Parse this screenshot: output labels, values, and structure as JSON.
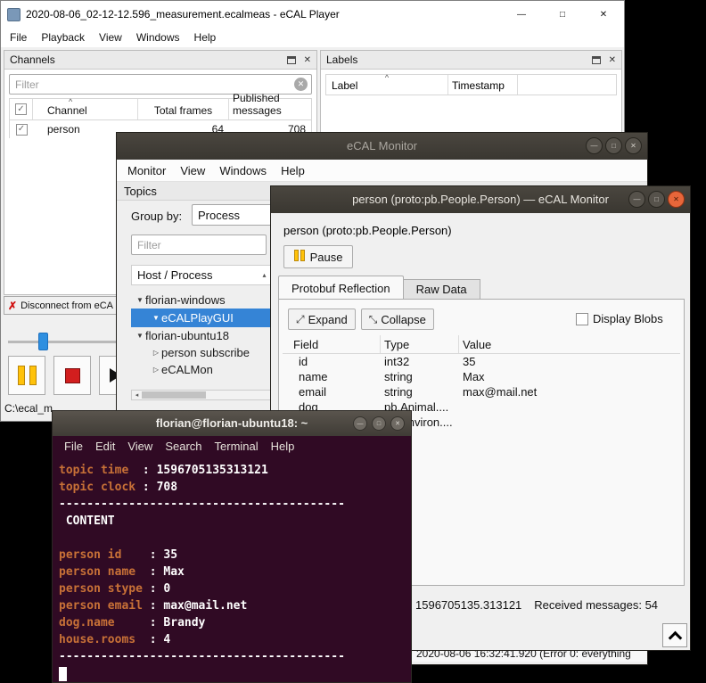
{
  "colors": {
    "selection_blue": "#3584D6",
    "pause_yellow": "#FFC20A",
    "stop_red": "#D21E1E",
    "close_orange": "#E8663A",
    "slider_blue": "#2E8FE0",
    "terminal_bg": "#300A24",
    "terminal_label_orange": "#C87137"
  },
  "icons": {
    "minimize": "—",
    "maximize": "□",
    "close": "✕",
    "clear": "✕",
    "check": "✓",
    "cross": "✗",
    "sort_caret": "^",
    "sort_arrow": "▴",
    "combo_arrow": "▾",
    "scroll_left": "◂",
    "expand_glyph": "⤢",
    "collapse_glyph": "⤡"
  },
  "player": {
    "title": "2020-08-06_02-12-12.596_measurement.ecalmeas - eCAL Player",
    "menu": [
      "File",
      "Playback",
      "View",
      "Windows",
      "Help"
    ],
    "channels": {
      "panel_title": "Channels",
      "filter_placeholder": "Filter",
      "columns": [
        "Channel",
        "Total frames",
        "Published messages"
      ],
      "row": {
        "channel": "person",
        "total_frames": "64",
        "published_messages": "708"
      },
      "disconnect_label": "Disconnect from eCA"
    },
    "labels": {
      "panel_title": "Labels",
      "columns": [
        "Label",
        "Timestamp"
      ]
    },
    "measurement_path": "C:\\ecal_m"
  },
  "monitor": {
    "title": "eCAL Monitor",
    "menu": [
      "Monitor",
      "View",
      "Windows",
      "Help"
    ],
    "topics_title": "Topics",
    "group_by_label": "Group by:",
    "group_by_value": "Process",
    "filter_placeholder": "Filter",
    "tree_header": "Host / Process",
    "tree": [
      {
        "arrow": "▼",
        "label": "florian-windows",
        "level": 0,
        "selected": false
      },
      {
        "arrow": "▼",
        "label": "eCALPlayGUI",
        "level": 1,
        "selected": true
      },
      {
        "arrow": "▼",
        "label": "florian-ubuntu18",
        "level": 0,
        "selected": false
      },
      {
        "arrow": "▷",
        "label": "person subscribe",
        "level": 1,
        "selected": false
      },
      {
        "arrow": "▷",
        "label": "eCALMon",
        "level": 1,
        "selected": false
      }
    ],
    "log_line": "2020-08-06 16:32:41.920 (Error 0: everything"
  },
  "person_window": {
    "title": "person (proto:pb.People.Person) — eCAL Monitor",
    "heading": "person (proto:pb.People.Person)",
    "pause_label": "Pause",
    "tabs": [
      "Protobuf Reflection",
      "Raw Data"
    ],
    "expand_label": "Expand",
    "collapse_label": "Collapse",
    "display_blobs_label": "Display Blobs",
    "table": {
      "columns": [
        "Field",
        "Type",
        "Value"
      ],
      "rows": [
        {
          "field": "id",
          "type": "int32",
          "value": "35"
        },
        {
          "field": "name",
          "type": "string",
          "value": "Max"
        },
        {
          "field": "email",
          "type": "string",
          "value": "max@mail.net"
        },
        {
          "field": "dog",
          "type": "pb.Animal....",
          "value": ""
        },
        {
          "field": "",
          "type": "pb.Environ....",
          "value": ""
        }
      ]
    },
    "status_time": "1596705135.313121",
    "status_messages": "Received messages: 54"
  },
  "terminal": {
    "title": "florian@florian-ubuntu18: ~",
    "menu": [
      "File",
      "Edit",
      "View",
      "Search",
      "Terminal",
      "Help"
    ],
    "lines": [
      {
        "n": "topic time",
        "r": "  : 1596705135313121"
      },
      {
        "n": "topic clock",
        "r": " : 708"
      },
      {
        "n": "",
        "r": "-----------------------------------------"
      },
      {
        "n": "",
        "r": " CONTENT"
      },
      {
        "n": "",
        "r": ""
      },
      {
        "n": "person id",
        "r": "    : 35"
      },
      {
        "n": "person name",
        "r": "  : Max"
      },
      {
        "n": "person stype",
        "r": " : 0"
      },
      {
        "n": "person email",
        "r": " : max@mail.net"
      },
      {
        "n": "dog.name",
        "r": "     : Brandy"
      },
      {
        "n": "house.rooms",
        "r": "  : 4"
      },
      {
        "n": "",
        "r": "-----------------------------------------"
      }
    ]
  }
}
